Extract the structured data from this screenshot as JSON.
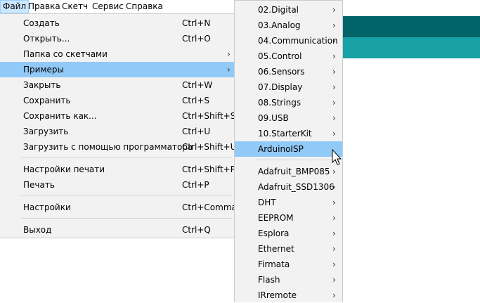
{
  "menubar": [
    "Файл",
    "Правка",
    "Скетч",
    "Сервис",
    "Справка"
  ],
  "file_menu": {
    "groups": [
      [
        {
          "label": "Создать",
          "shortcut": "Ctrl+N"
        },
        {
          "label": "Открыть...",
          "shortcut": "Ctrl+O"
        },
        {
          "label": "Папка со скетчами",
          "submenu": true
        },
        {
          "label": "Примеры",
          "submenu": true,
          "highlighted": true
        },
        {
          "label": "Закрыть",
          "shortcut": "Ctrl+W"
        },
        {
          "label": "Сохранить",
          "shortcut": "Ctrl+S"
        },
        {
          "label": "Сохранить как...",
          "shortcut": "Ctrl+Shift+S"
        },
        {
          "label": "Загрузить",
          "shortcut": "Ctrl+U"
        },
        {
          "label": "Загрузить с помощью программатора",
          "shortcut": "Ctrl+Shift+U"
        }
      ],
      [
        {
          "label": "Настройки печати",
          "shortcut": "Ctrl+Shift+P"
        },
        {
          "label": "Печать",
          "shortcut": "Ctrl+P"
        }
      ],
      [
        {
          "label": "Настройки",
          "shortcut": "Ctrl+Comma"
        }
      ],
      [
        {
          "label": "Выход",
          "shortcut": "Ctrl+Q"
        }
      ]
    ]
  },
  "examples_menu": {
    "groups": [
      [
        {
          "label": "02.Digital",
          "submenu": true
        },
        {
          "label": "03.Analog",
          "submenu": true
        },
        {
          "label": "04.Communication",
          "submenu": true
        },
        {
          "label": "05.Control",
          "submenu": true
        },
        {
          "label": "06.Sensors",
          "submenu": true
        },
        {
          "label": "07.Display",
          "submenu": true
        },
        {
          "label": "08.Strings",
          "submenu": true
        },
        {
          "label": "09.USB",
          "submenu": true
        },
        {
          "label": "10.StarterKit",
          "submenu": true
        },
        {
          "label": "ArduinoISP",
          "submenu": false,
          "highlighted": true
        }
      ],
      [
        {
          "label": "Adafruit_BMP085",
          "submenu": true
        },
        {
          "label": "Adafruit_SSD1306",
          "submenu": true
        },
        {
          "label": "DHT",
          "submenu": true
        },
        {
          "label": "EEPROM",
          "submenu": true
        },
        {
          "label": "Esplora",
          "submenu": true
        },
        {
          "label": "Ethernet",
          "submenu": true
        },
        {
          "label": "Firmata",
          "submenu": true
        },
        {
          "label": "Flash",
          "submenu": true
        },
        {
          "label": "IRremote",
          "submenu": true
        }
      ]
    ]
  },
  "colors": {
    "menu_bg": "#f2f2f2",
    "highlight": "#91c9f7",
    "menubar_active": "#cce8ff",
    "teal_dark": "#006468",
    "teal_light": "#17a1a5"
  }
}
